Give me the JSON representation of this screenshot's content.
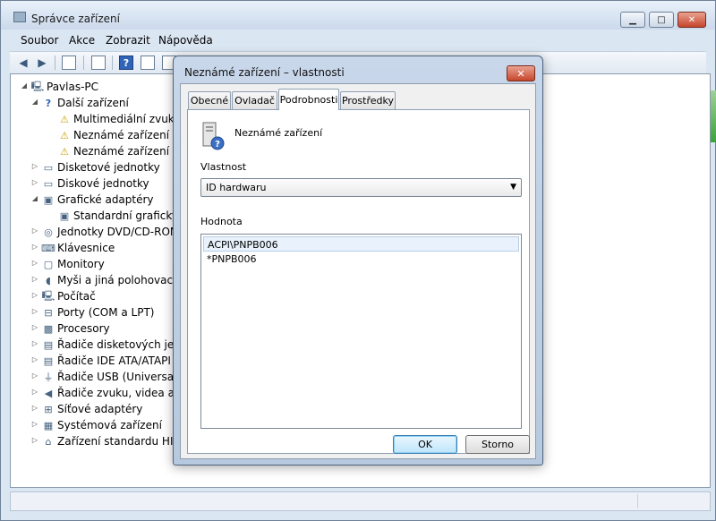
{
  "window": {
    "title": "Správce zařízení",
    "controls": {
      "minimize": "▁",
      "maximize": "□",
      "close": "✕"
    }
  },
  "menu": [
    "Soubor",
    "Akce",
    "Zobrazit",
    "Nápověda"
  ],
  "toolbar": {
    "icons": [
      "back-arrow-icon",
      "forward-arrow-icon",
      "properties-icon",
      "view-icon",
      "help-icon",
      "device-icon"
    ],
    "help_glyph": "?"
  },
  "tree": [
    {
      "label": "Pavlas-PC",
      "level": 0,
      "expander": "◢",
      "icon": "computer-icon"
    },
    {
      "label": "Další zařízení",
      "level": 1,
      "expander": "◢",
      "icon": "unknown-device-icon"
    },
    {
      "label": "Multimediální zvuk",
      "level": 2,
      "expander": "",
      "icon": "warning-device-icon"
    },
    {
      "label": "Neznámé zařízení",
      "level": 2,
      "expander": "",
      "icon": "warning-device-icon"
    },
    {
      "label": "Neznámé zařízení",
      "level": 2,
      "expander": "",
      "icon": "warning-device-icon"
    },
    {
      "label": "Disketové jednotky",
      "level": 1,
      "expander": "▷",
      "icon": "floppy-drive-icon"
    },
    {
      "label": "Diskové jednotky",
      "level": 1,
      "expander": "▷",
      "icon": "disk-drive-icon"
    },
    {
      "label": "Grafické adaptéry",
      "level": 1,
      "expander": "◢",
      "icon": "display-adapter-icon"
    },
    {
      "label": "Standardní grafický",
      "level": 2,
      "expander": "",
      "icon": "display-adapter-icon"
    },
    {
      "label": "Jednotky DVD/CD-ROM",
      "level": 1,
      "expander": "▷",
      "icon": "dvd-drive-icon"
    },
    {
      "label": "Klávesnice",
      "level": 1,
      "expander": "▷",
      "icon": "keyboard-icon"
    },
    {
      "label": "Monitory",
      "level": 1,
      "expander": "▷",
      "icon": "monitor-icon"
    },
    {
      "label": "Myši a jiná polohovací",
      "level": 1,
      "expander": "▷",
      "icon": "mouse-icon"
    },
    {
      "label": "Počítač",
      "level": 1,
      "expander": "▷",
      "icon": "computer-icon"
    },
    {
      "label": "Porty (COM a LPT)",
      "level": 1,
      "expander": "▷",
      "icon": "port-icon"
    },
    {
      "label": "Procesory",
      "level": 1,
      "expander": "▷",
      "icon": "processor-icon"
    },
    {
      "label": "Řadiče disketových jed",
      "level": 1,
      "expander": "▷",
      "icon": "controller-icon"
    },
    {
      "label": "Řadiče IDE ATA/ATAPI",
      "level": 1,
      "expander": "▷",
      "icon": "controller-icon"
    },
    {
      "label": "Řadiče USB (Universal",
      "level": 1,
      "expander": "▷",
      "icon": "usb-icon"
    },
    {
      "label": "Řadiče zvuku, videa a h",
      "level": 1,
      "expander": "▷",
      "icon": "speaker-icon"
    },
    {
      "label": "Síťové adaptéry",
      "level": 1,
      "expander": "▷",
      "icon": "network-icon"
    },
    {
      "label": "Systémová zařízení",
      "level": 1,
      "expander": "▷",
      "icon": "system-device-icon"
    },
    {
      "label": "Zařízení standardu HID",
      "level": 1,
      "expander": "▷",
      "icon": "hid-device-icon"
    }
  ],
  "dialog": {
    "title": "Neznámé zařízení – vlastnosti",
    "close_glyph": "✕",
    "tabs": [
      {
        "label": "Obecné",
        "active": false
      },
      {
        "label": "Ovladač",
        "active": false
      },
      {
        "label": "Podrobnosti",
        "active": true
      },
      {
        "label": "Prostředky",
        "active": false
      }
    ],
    "device_name": "Neznámé zařízení",
    "property_label": "Vlastnost",
    "property_value": "ID hardwaru",
    "value_label": "Hodnota",
    "values": [
      "ACPI\\PNPB006",
      "*PNPB006"
    ],
    "ok_label": "OK",
    "cancel_label": "Storno"
  }
}
